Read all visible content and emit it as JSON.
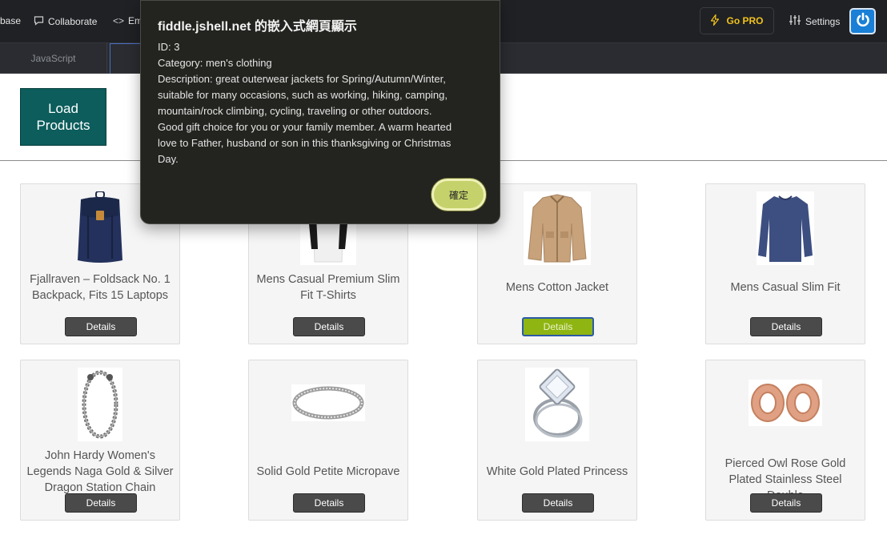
{
  "topbar": {
    "left_cut_label": "base",
    "collaborate_label": "Collaborate",
    "embed_cut_label": "Em",
    "gopro_label": "Go PRO",
    "settings_label": "Settings"
  },
  "tabs": {
    "javascript_label": "JavaScript"
  },
  "load_button_label": "Load Products",
  "products": [
    {
      "title": "Fjallraven – Foldsack No. 1 Backpack, Fits 15 Laptops",
      "details_label": "Details",
      "icon": "backpack-image"
    },
    {
      "title": "Mens Casual Premium Slim Fit T-Shirts",
      "details_label": "Details",
      "icon": "tshirt-image"
    },
    {
      "title": "Mens Cotton Jacket",
      "details_label": "Details",
      "icon": "jacket-image",
      "active": true
    },
    {
      "title": "Mens Casual Slim Fit",
      "details_label": "Details",
      "icon": "sweater-image"
    },
    {
      "title": "John Hardy Women's Legends Naga Gold & Silver Dragon Station Chain Bracelet",
      "details_label": "Details",
      "icon": "bracelet-image"
    },
    {
      "title": "Solid Gold Petite Micropave",
      "details_label": "Details",
      "icon": "ring-image"
    },
    {
      "title": "White Gold Plated Princess",
      "details_label": "Details",
      "icon": "diamond-ring-image"
    },
    {
      "title": "Pierced Owl Rose Gold Plated Stainless Steel Double",
      "details_label": "Details",
      "icon": "rose-gold-plugs-image"
    }
  ],
  "dialog": {
    "title": "fiddle.jshell.net 的嵌入式網頁顯示",
    "lines": [
      "ID: 3",
      "Category: men's clothing",
      "Description: great outerwear jackets for Spring/Autumn/Winter,",
      "suitable for many occasions, such as working, hiking, camping,",
      "mountain/rock climbing, cycling, traveling or other outdoors.",
      "Good gift choice for you or your family member. A warm hearted",
      "love to Father, husband or son in this thanksgiving or Christmas",
      "Day."
    ],
    "ok_label": "確定"
  },
  "colors": {
    "topbar_bg": "#1f2125",
    "gopro": "#f2c21b",
    "load_button_bg": "#0c5d5c",
    "details_bg": "#4a4a4a",
    "details_active_bg": "#8fb512",
    "dialog_bg": "#23241f",
    "dialog_ok_bg": "#c5d26b"
  }
}
